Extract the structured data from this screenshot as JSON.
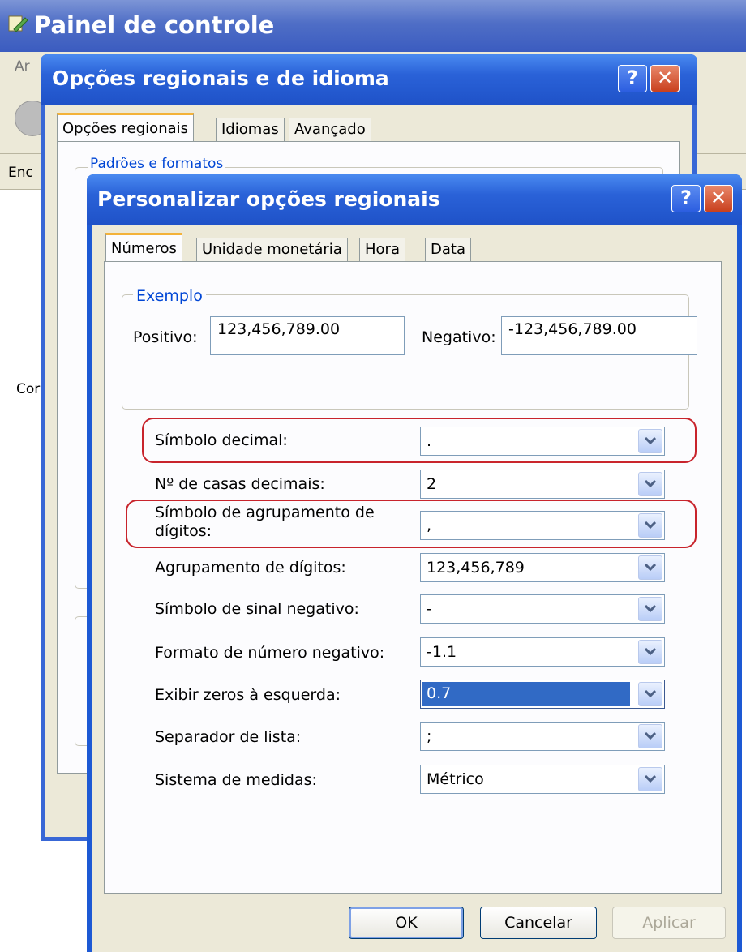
{
  "control_panel": {
    "title": "Painel de controle",
    "menu_fragment": "Ar",
    "address_fragment": "Enc",
    "side_fragment": "Cor"
  },
  "regional_dialog": {
    "title": "Opções regionais e de idioma",
    "tabs": [
      "Opções regionais",
      "Idiomas",
      "Avançado"
    ],
    "active_tab": "Opções regionais",
    "group_label": "Padrões e formatos"
  },
  "customize_dialog": {
    "title": "Personalizar opções regionais",
    "help_label": "?",
    "close_label": "✕",
    "tabs": [
      "Números",
      "Unidade monetária",
      "Hora",
      "Data"
    ],
    "active_tab": "Números",
    "example": {
      "label": "Exemplo",
      "positive_label": "Positivo:",
      "positive_value": "123,456,789.00",
      "negative_label": "Negativo:",
      "negative_value": "-123,456,789.00"
    },
    "fields": [
      {
        "label": "Símbolo decimal:",
        "value": ".",
        "highlighted": true
      },
      {
        "label": "Nº de casas decimais:",
        "value": "2"
      },
      {
        "label": "Símbolo de agrupamento de dígitos:",
        "label_line1": "Símbolo de agrupamento de",
        "label_line2": "dígitos:",
        "value": ",",
        "highlighted": true
      },
      {
        "label": "Agrupamento de dígitos:",
        "value": "123,456,789"
      },
      {
        "label": "Símbolo de sinal negativo:",
        "value": "-"
      },
      {
        "label": "Formato de número negativo:",
        "value": "-1.1"
      },
      {
        "label": "Exibir zeros à esquerda:",
        "value": "0.7",
        "selected": true
      },
      {
        "label": "Separador de lista:",
        "value": ";"
      },
      {
        "label": "Sistema de medidas:",
        "value": "Métrico"
      }
    ],
    "buttons": {
      "ok": "OK",
      "cancel": "Cancelar",
      "apply": "Aplicar"
    }
  },
  "colors": {
    "title_bar": "#2a62d8",
    "highlight_outline": "#c8242c",
    "selection": "#316ac5",
    "group_label": "#0046d5"
  },
  "icons": [
    "control-panel-icon",
    "back-arrow-icon",
    "help-icon",
    "close-icon",
    "dropdown-arrow-icon"
  ]
}
